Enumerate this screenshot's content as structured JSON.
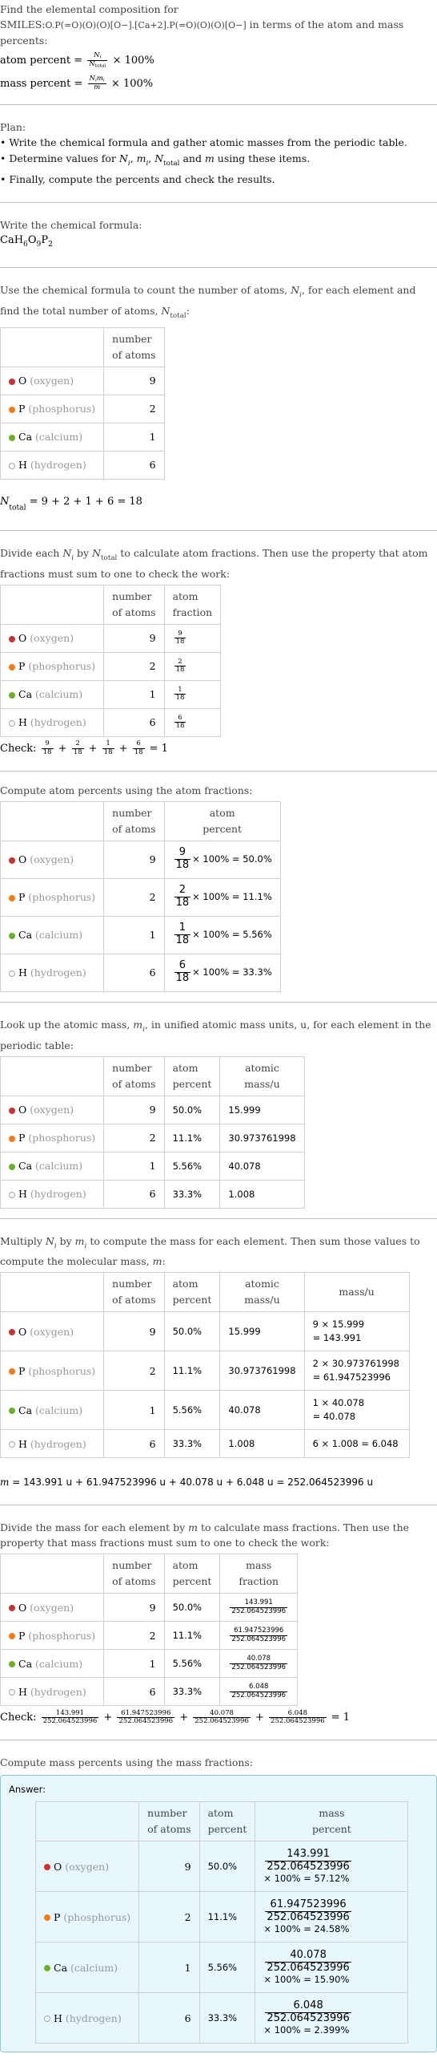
{
  "header": {
    "line1": "Find the elemental composition for",
    "smiles_label": "SMILES:",
    "smiles": "O.P(=O)(O)(O)[O−].[Ca+2].P(=O)(O)(O)[O−]",
    "line2_tail": " in terms of the atom and mass",
    "line3": "percents:",
    "atom_percent_label": "atom percent = ",
    "mass_percent_label": "mass percent = ",
    "times100": "× 100%"
  },
  "plan": {
    "title": "Plan:",
    "items": [
      "Write the chemical formula and gather atomic masses from the periodic table.",
      "Determine values for N_i, m_i, N_total and m using these items.",
      "Finally, compute the percents and check the results."
    ]
  },
  "formula_section": {
    "intro": "Write the chemical formula:",
    "formula": "CaH6O9P2"
  },
  "count_section": {
    "intro": "Use the chemical formula to count the number of atoms, N_i, for each element and find the total number of atoms, N_total:",
    "total_equation": "= 9 + 2 + 1 + 6 = 18"
  },
  "columns": {
    "number_of_atoms": [
      "number",
      "of atoms"
    ],
    "atom_fraction": [
      "atom",
      "fraction"
    ],
    "atom_percent": [
      "atom",
      "percent"
    ],
    "atomic_mass": [
      "atomic",
      "mass/u"
    ],
    "mass": "mass/u",
    "mass_fraction": [
      "mass",
      "fraction"
    ],
    "mass_percent": [
      "mass",
      "percent"
    ]
  },
  "elements": [
    {
      "symbol": "O",
      "name": "(oxygen)",
      "color": "#c83232",
      "count": "9",
      "fraction_num": "9",
      "fraction_den": "18",
      "atom_percent": "50.0%",
      "atomic_mass": "15.999",
      "mass_line1": "9 × 15.999",
      "mass_line2": "= 143.991",
      "mass_value": "143.991",
      "mass_percent": "57.12%"
    },
    {
      "symbol": "P",
      "name": "(phosphorus)",
      "color": "#f07d18",
      "count": "2",
      "fraction_num": "2",
      "fraction_den": "18",
      "atom_percent": "11.1%",
      "atomic_mass": "30.973761998",
      "mass_line1": "2 × 30.973761998",
      "mass_line2": "= 61.947523996",
      "mass_value": "61.947523996",
      "mass_percent": "24.58%"
    },
    {
      "symbol": "Ca",
      "name": "(calcium)",
      "color": "#6cb02c",
      "count": "1",
      "fraction_num": "1",
      "fraction_den": "18",
      "atom_percent": "5.56%",
      "atomic_mass": "40.078",
      "mass_line1": "1 × 40.078",
      "mass_line2": "= 40.078",
      "mass_value": "40.078",
      "mass_percent": "15.90%"
    },
    {
      "symbol": "H",
      "name": "(hydrogen)",
      "color": "#ffffff",
      "count": "6",
      "fraction_num": "6",
      "fraction_den": "18",
      "atom_percent": "33.3%",
      "atomic_mass": "1.008",
      "mass_line1": "6 × 1.008 = 6.048",
      "mass_line2": "",
      "mass_value": "6.048",
      "mass_percent": "2.399%"
    }
  ],
  "fraction_section": {
    "intro": "Divide each N_i by N_total to calculate atom fractions. Then use the property that atom fractions must sum to one to check the work:",
    "check_label": "Check:",
    "check_result": "= 1"
  },
  "atom_percent_section": {
    "intro": "Compute atom percents using the atom fractions:",
    "times": "× 100% = "
  },
  "atomic_mass_section": {
    "intro": "Look up the atomic mass, m_i, in unified atomic mass units, u, for each element in the periodic table:"
  },
  "mass_section": {
    "intro": "Multiply N_i by m_i to compute the mass for each element. Then sum those values to compute the molecular mass, m:",
    "equation": "= 143.991 u + 61.947523996 u + 40.078 u + 6.048 u = 252.064523996 u"
  },
  "mass_fraction_section": {
    "intro": "Divide the mass for each element by m to calculate mass fractions. Then use the property that mass fractions must sum to one to check the work:",
    "denominator": "252.064523996",
    "check_label": "Check:",
    "check_result": "= 1"
  },
  "mass_percent_section": {
    "intro": "Compute mass percents using the mass fractions:",
    "answer_label": "Answer:",
    "times": "× 100% = "
  }
}
